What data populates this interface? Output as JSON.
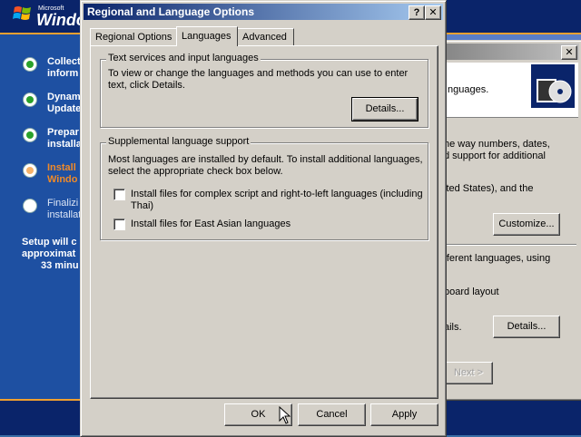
{
  "setup": {
    "logo_small": "Microsoft",
    "logo_text": "Windo",
    "steps": [
      {
        "lines": [
          "Collect",
          "inform"
        ],
        "state": "done"
      },
      {
        "lines": [
          "Dynam",
          "Update"
        ],
        "state": "done"
      },
      {
        "lines": [
          "Prepar",
          "installa"
        ],
        "state": "done"
      },
      {
        "lines": [
          "Install",
          "Windo"
        ],
        "state": "current"
      },
      {
        "lines": [
          "Finalizi",
          "installat"
        ],
        "state": "pending"
      }
    ],
    "eta": [
      "Setup will c",
      "approximat",
      "33 minu"
    ]
  },
  "wizard": {
    "lines": [
      "nguages.",
      "he way numbers, dates,",
      "d support for additional",
      "ited States), and the",
      "fferent languages, using",
      "board layout",
      "ails."
    ],
    "customize_label": "Customize...",
    "details_label": "Details...",
    "next_label": "Next >"
  },
  "dialog": {
    "title": "Regional and Language Options",
    "help_label": "?",
    "close_label": "✕",
    "tabs": [
      {
        "label": "Regional Options"
      },
      {
        "label": "Languages"
      },
      {
        "label": "Advanced"
      }
    ],
    "text_services": {
      "title": "Text services and input languages",
      "line1": "To view or change the languages and methods you can use to enter",
      "line2": "text, click Details.",
      "details_label": "Details..."
    },
    "supplemental": {
      "title": "Supplemental language support",
      "line1": "Most languages are installed by default. To install additional languages,",
      "line2": "select the appropriate check box below.",
      "complex_line1": "Install files for complex script and right-to-left languages (including",
      "complex_line2": "Thai)",
      "complex_checked": false,
      "east_asian": "Install files for East Asian languages",
      "east_asian_checked": false
    },
    "buttons": {
      "ok": "OK",
      "cancel": "Cancel",
      "apply": "Apply"
    }
  }
}
